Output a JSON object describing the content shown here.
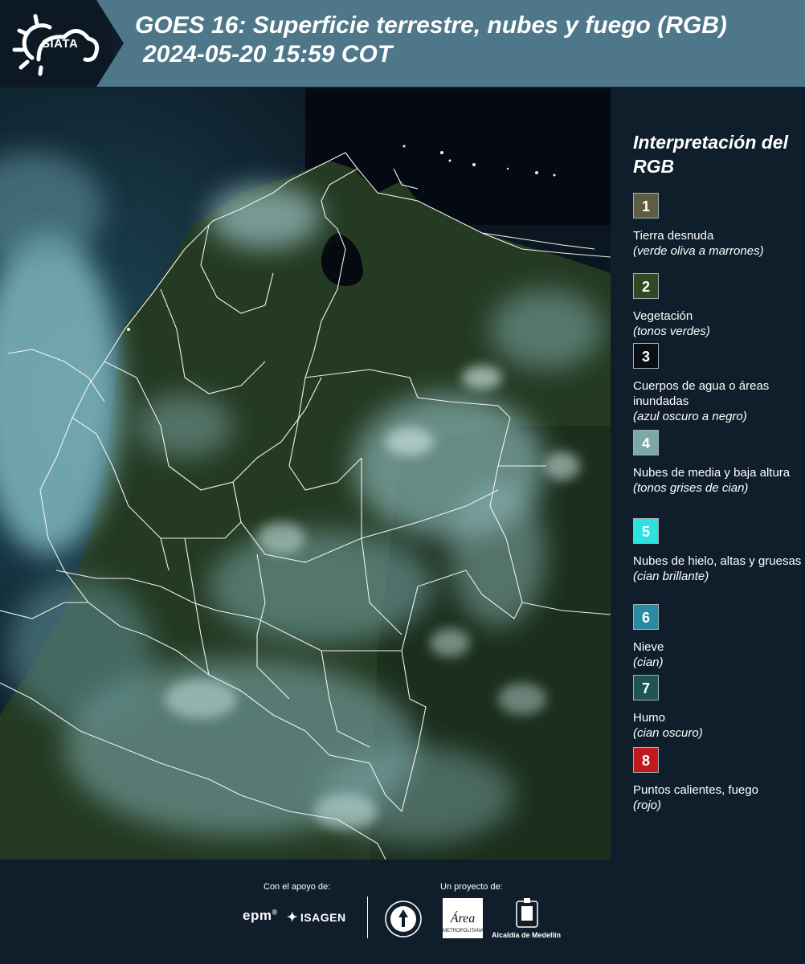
{
  "header": {
    "logo_text": "SIATA",
    "title": "GOES 16: Superficie terrestre, nubes y fuego (RGB)",
    "datetime": "2024-05-20 15:59 COT"
  },
  "legend": {
    "title": "Interpretación del RGB",
    "items": [
      {
        "number": "1",
        "color": "#5e5d43",
        "label": "Tierra desnuda",
        "note": "(verde oliva a marrones)"
      },
      {
        "number": "2",
        "color": "#2f4a22",
        "label": "Vegetación",
        "note": "(tonos verdes)"
      },
      {
        "number": "3",
        "color": "#0b0f14",
        "label": "Cuerpos de agua o áreas inundadas",
        "note": "(azul oscuro a negro)"
      },
      {
        "number": "4",
        "color": "#7da8a8",
        "label": "Nubes de media y baja altura",
        "note": "(tonos grises de cian)"
      },
      {
        "number": "5",
        "color": "#2fe1df",
        "label": "Nubes de hielo, altas y gruesas",
        "note": "(cian brillante)"
      },
      {
        "number": "6",
        "color": "#2a8aa3",
        "label": "Nieve",
        "note": "(cian)"
      },
      {
        "number": "7",
        "color": "#1f5552",
        "label": "Humo",
        "note": "(cian oscuro)"
      },
      {
        "number": "8",
        "color": "#c2191c",
        "label": "Puntos calientes, fuego",
        "note": "(rojo)"
      }
    ]
  },
  "footer": {
    "support_label": "Con el apoyo de:",
    "project_label": "Un proyecto de:",
    "sponsors": [
      "epm",
      "ISAGEN"
    ],
    "area_logo_text": "Área",
    "area_caption": "METROPOLITANA",
    "medellin_label": "Alcaldía de Medellín"
  }
}
